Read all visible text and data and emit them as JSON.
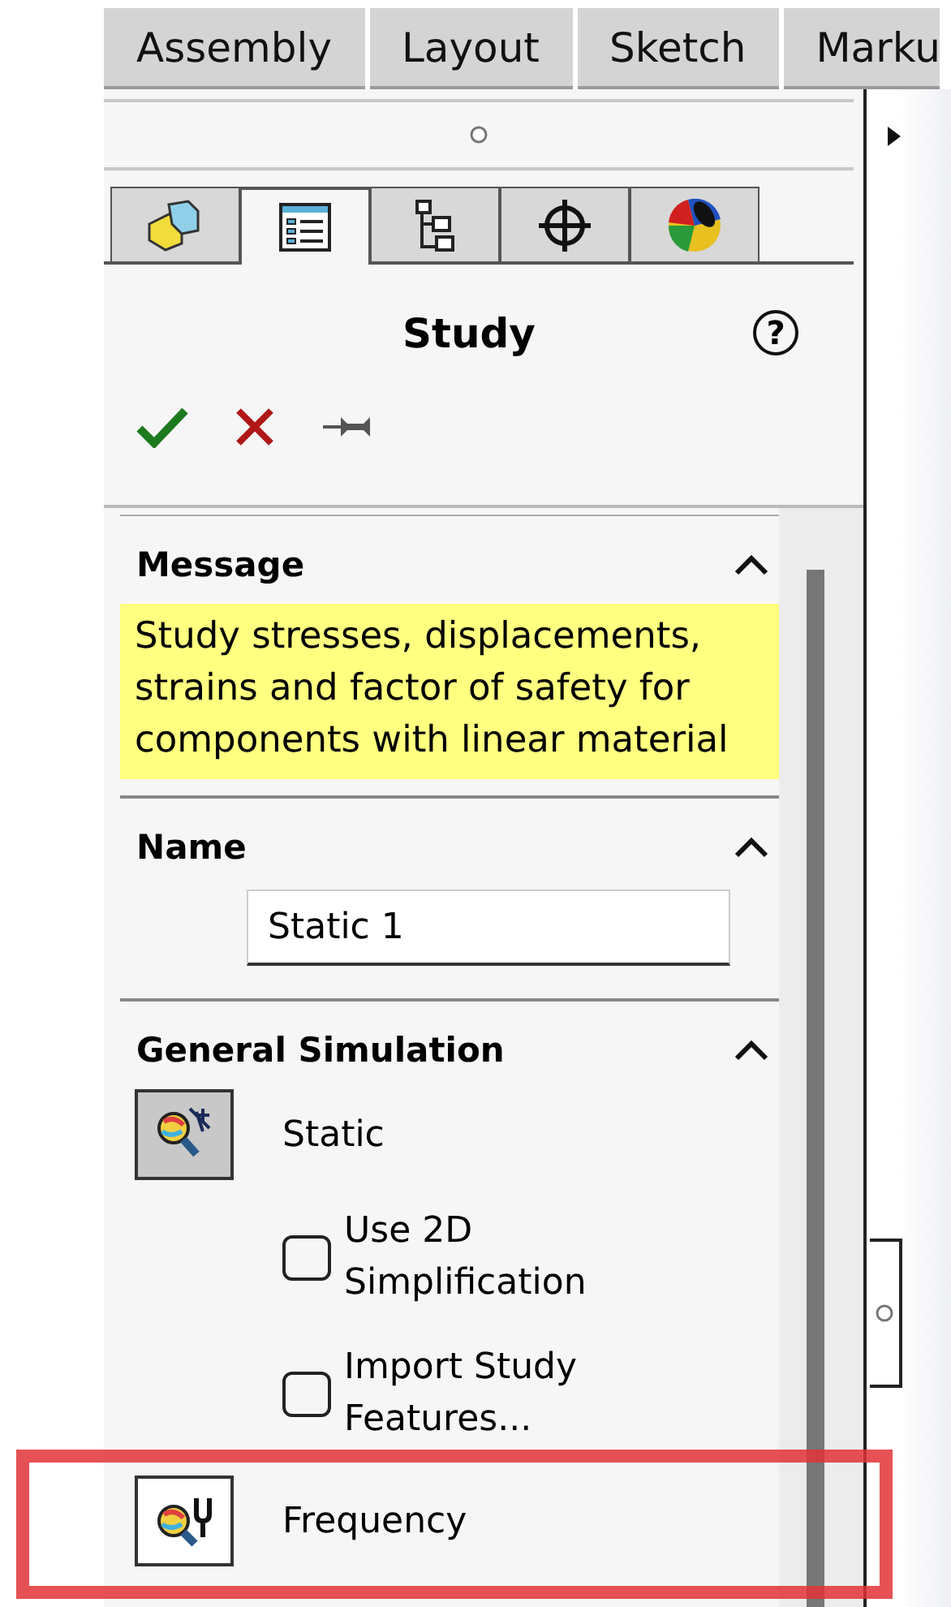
{
  "ribbon_tabs": [
    {
      "label": "Assembly"
    },
    {
      "label": "Layout"
    },
    {
      "label": "Sketch"
    },
    {
      "label": "Marku"
    }
  ],
  "panel_tabs": [
    {
      "selected": false
    },
    {
      "selected": true
    },
    {
      "selected": false
    },
    {
      "selected": false
    },
    {
      "selected": false
    }
  ],
  "panel": {
    "title": "Study",
    "help": "?"
  },
  "sections": [
    {
      "kind": "message",
      "title": "Message",
      "expanded": true,
      "text": "Study stresses, displacements, strains and factor of safety  for components with linear material"
    },
    {
      "kind": "name",
      "title": "Name",
      "expanded": true,
      "value": "Static 1"
    },
    {
      "kind": "study-types",
      "title": "General Simulation",
      "expanded": true,
      "items": [
        {
          "kind": "study-type",
          "label": "Static",
          "selected": true,
          "highlighted": false
        },
        {
          "kind": "option",
          "label": "Use 2D Simplification",
          "checked": false
        },
        {
          "kind": "option",
          "label": "Import Study Features...",
          "checked": false
        },
        {
          "kind": "study-type",
          "label": "Frequency",
          "selected": false,
          "highlighted": true
        }
      ]
    }
  ]
}
